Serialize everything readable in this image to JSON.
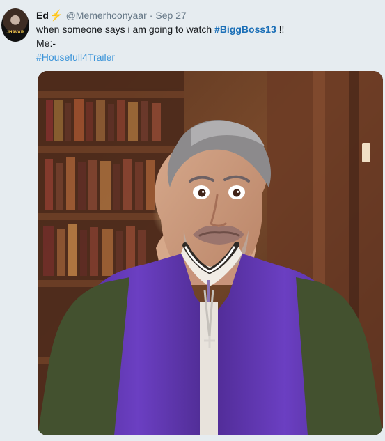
{
  "tweet": {
    "avatar_text": "JHAVAR",
    "name": "Ed",
    "bolt": "⚡",
    "handle": "@Memerhoonyaar",
    "dot": "·",
    "date": "Sep 27",
    "text_before_hashtag": "when someone says i am going to watch ",
    "hashtag_main": "#BiggBoss13",
    "text_after_hashtag": " !!",
    "line2": "Me:-",
    "hashtag_secondary": "#Housefull4Trailer"
  },
  "colors": {
    "background": "#e6ecf0",
    "name": "#14171a",
    "meta": "#657786",
    "link": "#1b6fb7",
    "secondary_link": "#3b94d9",
    "bolt": "#f4b400"
  }
}
